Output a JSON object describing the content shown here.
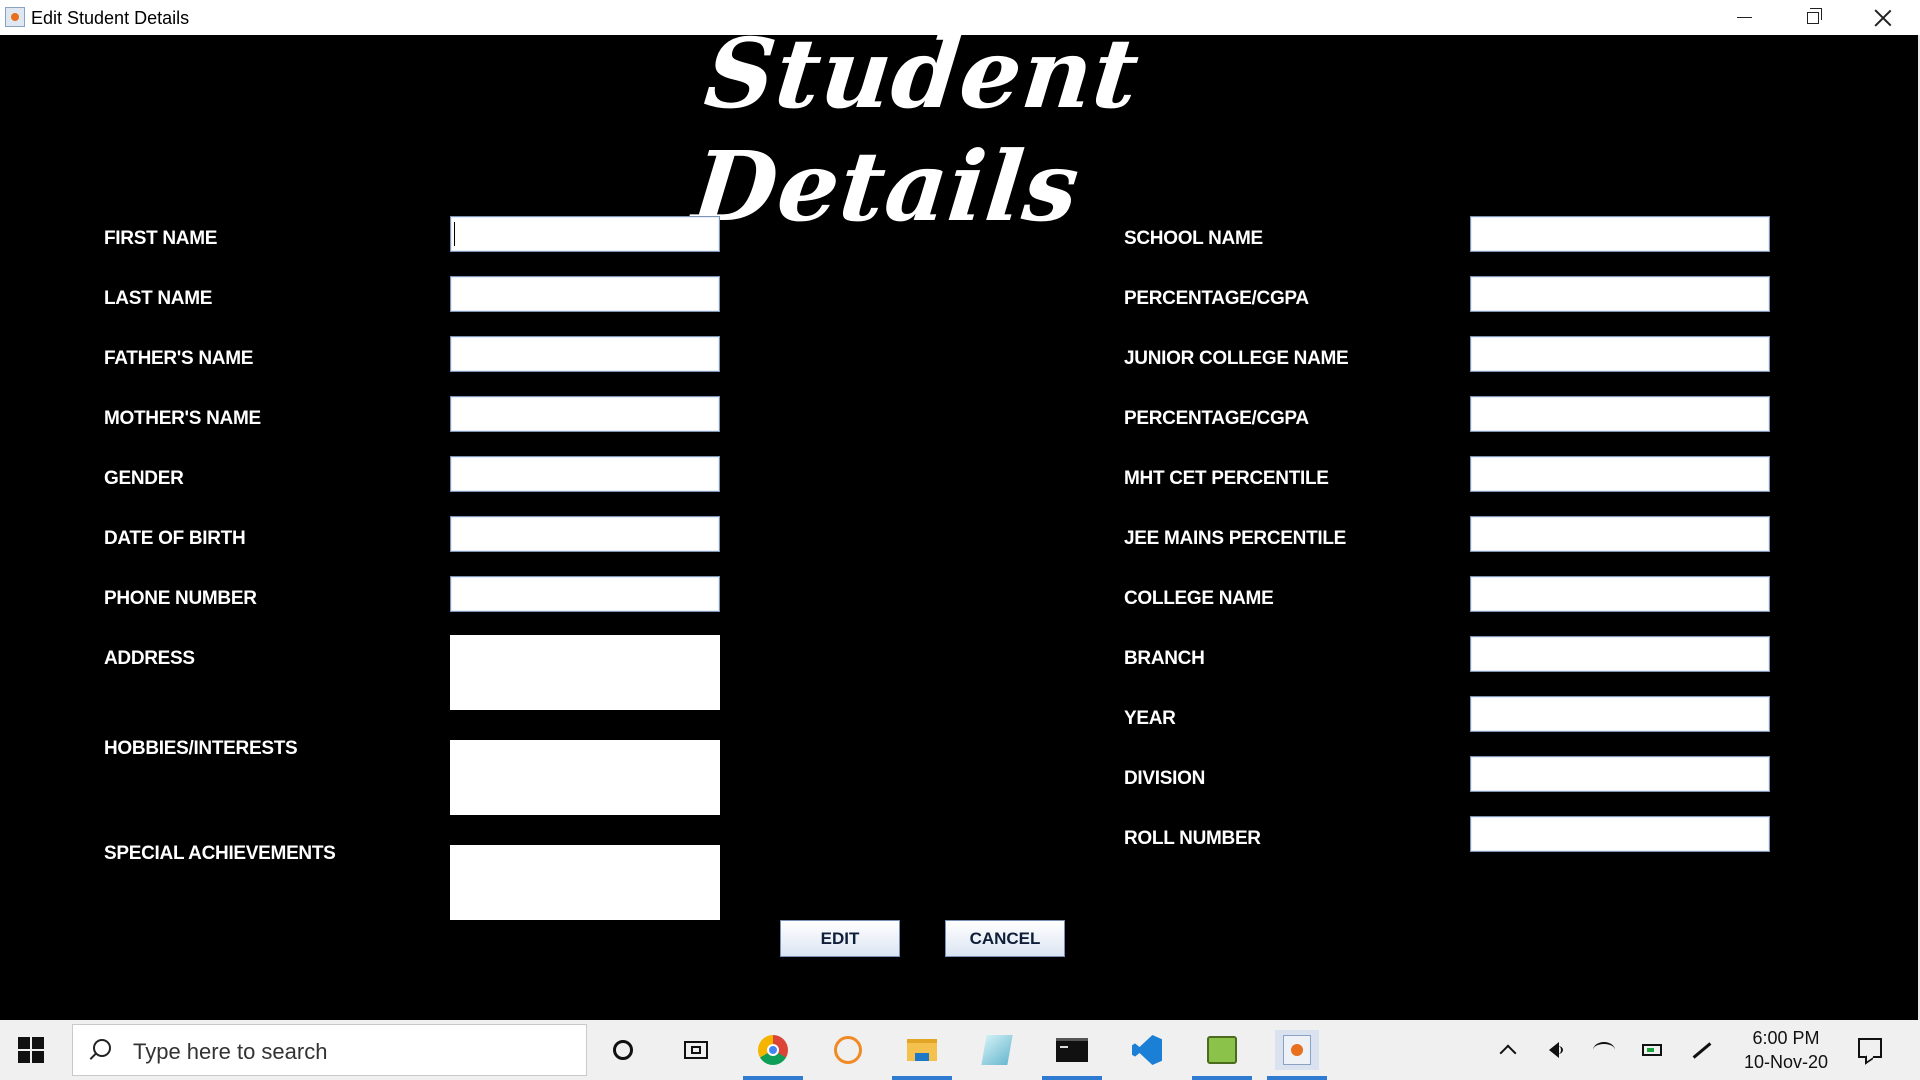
{
  "window": {
    "title": "Edit Student Details"
  },
  "heading": "Student Details",
  "left_fields": [
    {
      "label": "FIRST NAME",
      "value": ""
    },
    {
      "label": "LAST NAME",
      "value": ""
    },
    {
      "label": "FATHER'S NAME",
      "value": ""
    },
    {
      "label": "MOTHER'S NAME",
      "value": ""
    },
    {
      "label": "GENDER",
      "value": ""
    },
    {
      "label": "DATE OF BIRTH",
      "value": ""
    },
    {
      "label": "PHONE NUMBER",
      "value": ""
    }
  ],
  "left_areas": [
    {
      "label": "ADDRESS",
      "value": ""
    },
    {
      "label": "HOBBIES/INTERESTS",
      "value": ""
    },
    {
      "label": "SPECIAL ACHIEVEMENTS",
      "value": ""
    }
  ],
  "right_fields": [
    {
      "label": "SCHOOL NAME",
      "value": ""
    },
    {
      "label": "PERCENTAGE/CGPA",
      "value": ""
    },
    {
      "label": "JUNIOR COLLEGE NAME",
      "value": ""
    },
    {
      "label": "PERCENTAGE/CGPA",
      "value": ""
    },
    {
      "label": "MHT CET PERCENTILE",
      "value": ""
    },
    {
      "label": "JEE MAINS PERCENTILE",
      "value": ""
    },
    {
      "label": "COLLEGE NAME",
      "value": ""
    },
    {
      "label": "BRANCH",
      "value": ""
    },
    {
      "label": "YEAR",
      "value": ""
    },
    {
      "label": "DIVISION",
      "value": ""
    },
    {
      "label": "ROLL NUMBER",
      "value": ""
    }
  ],
  "buttons": {
    "edit": "EDIT",
    "cancel": "CANCEL"
  },
  "taskbar": {
    "search_placeholder": "Type here to search",
    "icons": [
      "start-icon",
      "search-icon",
      "cortana-icon",
      "task-view-icon",
      "chrome-icon",
      "eclipse-icon",
      "file-explorer-icon",
      "notepad-icon",
      "command-prompt-icon",
      "vscode-icon",
      "game-icon",
      "java-icon"
    ],
    "clock_time": "6:00 PM",
    "clock_date": "10-Nov-20"
  },
  "colors": {
    "background": "#000000",
    "taskbar": "#f0f0f0",
    "accent": "#2e7bd1"
  }
}
